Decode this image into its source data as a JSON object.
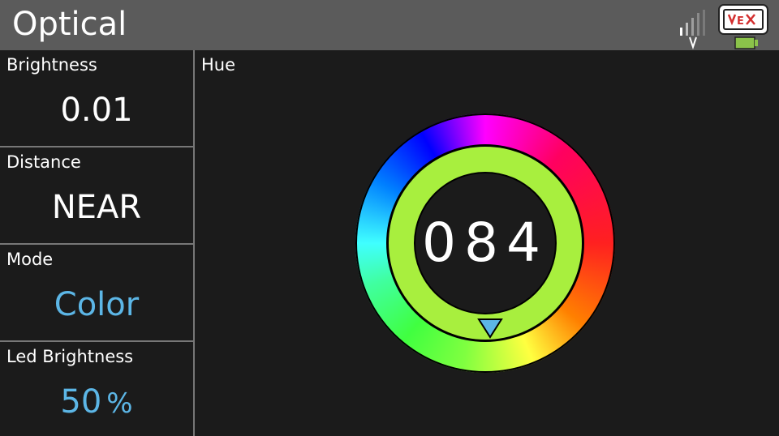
{
  "header": {
    "title": "Optical",
    "signal_icon": "signal-bars-icon",
    "brain_icon": "vex-brain-icon",
    "brain_logo_text": "VEX",
    "battery_color": "#8bc34a"
  },
  "sidebar": {
    "items": [
      {
        "label": "Brightness",
        "value": "0.01"
      },
      {
        "label": "Distance",
        "value": "NEAR"
      },
      {
        "label": "Mode",
        "value": "Color"
      },
      {
        "label": "Led Brightness",
        "value": "50",
        "unit": "%"
      }
    ]
  },
  "main": {
    "label": "Hue",
    "hue_value": "084",
    "selected_color": "#a8ef3e",
    "pointer_color": "#5cb6e6"
  },
  "colors": {
    "accent": "#5cb6e6",
    "header_bg": "#5b5b5b",
    "background": "#1b1b1b"
  }
}
